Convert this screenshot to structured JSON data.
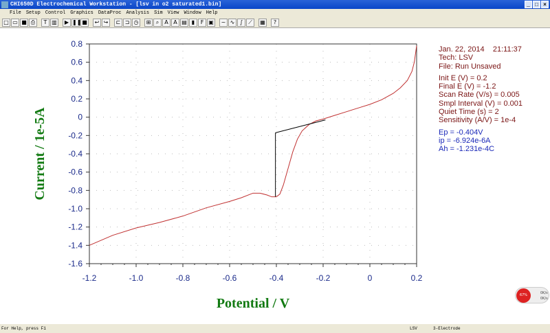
{
  "window": {
    "title": "CHI650D Electrochemical Workstation - [lsv in o2 saturated1.bin]"
  },
  "menu": [
    "File",
    "Setup",
    "Control",
    "Graphics",
    "DataProc",
    "Analysis",
    "Sim",
    "View",
    "Window",
    "Help"
  ],
  "toolbar": [
    "new",
    "open",
    "save",
    "print",
    "text",
    "template",
    "run",
    "pause",
    "stop",
    "reverse",
    "undo",
    "macro1",
    "macro2",
    "timer",
    "graph",
    "zoom",
    "peak1",
    "peak2",
    "chart",
    "color",
    "font",
    "copy",
    "smooth",
    "derivative",
    "integrate",
    "overlay",
    "table",
    "help"
  ],
  "toolbar_glyphs": [
    "□",
    "▭",
    "■",
    "⎙",
    "T",
    "▥",
    "▶",
    "❚❚",
    "■",
    "↩",
    "↪",
    "⊏",
    "⊐",
    "◷",
    "⊞",
    "⌕",
    "A",
    "A",
    "▤",
    "▮",
    "F",
    "▣",
    "~",
    "∿",
    "∫",
    "⟋",
    "▦",
    "?"
  ],
  "info": {
    "date": "Jan. 22, 2014    21:11:37",
    "tech": "Tech: LSV",
    "file": "File: Run Unsaved",
    "params": [
      "Init E (V) = 0.2",
      "Final E (V) = -1.2",
      "Scan Rate (V/s) = 0.005",
      "Smpl Interval (V) = 0.001",
      "Quiet Time (s) = 2",
      "Sensitivity (A/V) = 1e-4"
    ],
    "results": [
      "Ep = -0.404V",
      "ip = -6.924e-6A",
      "Ah = -1.231e-4C"
    ]
  },
  "chart_data": {
    "type": "line",
    "xlabel": "Potential / V",
    "ylabel": "Current / 1e-5A",
    "xlim": [
      -1.2,
      0.2
    ],
    "ylim": [
      -1.6,
      0.8
    ],
    "xticks": [
      "-1.2",
      "-1.0",
      "-0.8",
      "-0.6",
      "-0.4",
      "-0.2",
      "0",
      "0.2"
    ],
    "yticks": [
      "0.8",
      "0.6",
      "0.4",
      "0.2",
      "0",
      "-0.2",
      "-0.4",
      "-0.6",
      "-0.8",
      "-1.0",
      "-1.2",
      "-1.4",
      "-1.6"
    ],
    "series": [
      {
        "name": "LSV",
        "color": "#c03030",
        "x": [
          -1.2,
          -1.1,
          -1.0,
          -0.9,
          -0.8,
          -0.7,
          -0.6,
          -0.55,
          -0.5,
          -0.47,
          -0.44,
          -0.42,
          -0.4,
          -0.385,
          -0.37,
          -0.35,
          -0.33,
          -0.31,
          -0.29,
          -0.26,
          -0.23,
          -0.2,
          -0.15,
          -0.1,
          -0.05,
          0,
          0.05,
          0.1,
          0.13,
          0.16,
          0.18,
          0.19,
          0.2
        ],
        "y": [
          -1.4,
          -1.29,
          -1.21,
          -1.15,
          -1.08,
          -0.99,
          -0.92,
          -0.88,
          -0.83,
          -0.83,
          -0.85,
          -0.87,
          -0.87,
          -0.84,
          -0.74,
          -0.56,
          -0.38,
          -0.24,
          -0.15,
          -0.08,
          -0.04,
          -0.02,
          0.02,
          0.06,
          0.1,
          0.14,
          0.19,
          0.26,
          0.32,
          0.4,
          0.5,
          0.6,
          0.78
        ]
      }
    ],
    "baseline": {
      "x": [
        -0.404,
        -0.19
      ],
      "y": [
        -0.17,
        -0.03
      ],
      "color": "#000000"
    },
    "peak": {
      "x": -0.404,
      "ybase": -0.17,
      "ypeak": -0.87
    }
  },
  "status": {
    "help": "For Help, press F1",
    "mode": "LSV",
    "electrode": "3-Electrode"
  },
  "badge": {
    "pct": "67%",
    "up": "0K/s",
    "down": "0K/s"
  }
}
